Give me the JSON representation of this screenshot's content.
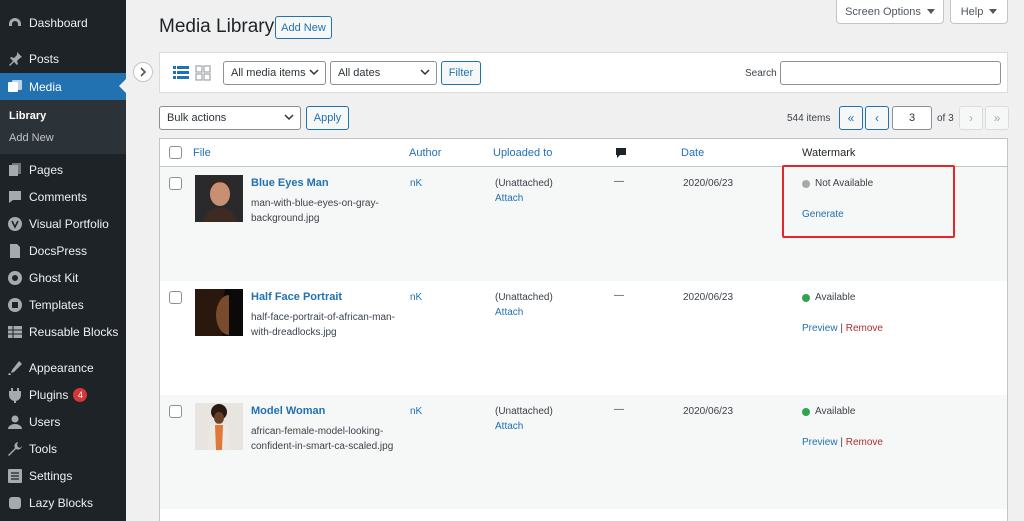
{
  "sidebar": {
    "items": [
      {
        "label": "Dashboard",
        "icon": "dashboard-icon"
      },
      {
        "label": "Posts",
        "icon": "pin-icon"
      },
      {
        "label": "Media",
        "icon": "media-icon"
      },
      {
        "label": "Pages",
        "icon": "pages-icon"
      },
      {
        "label": "Comments",
        "icon": "comments-icon"
      },
      {
        "label": "Visual Portfolio",
        "icon": "visual-portfolio-icon"
      },
      {
        "label": "DocsPress",
        "icon": "docs-icon"
      },
      {
        "label": "Ghost Kit",
        "icon": "ghost-kit-icon"
      },
      {
        "label": "Templates",
        "icon": "templates-icon"
      },
      {
        "label": "Reusable Blocks",
        "icon": "blocks-icon"
      },
      {
        "label": "Appearance",
        "icon": "appearance-icon"
      },
      {
        "label": "Plugins",
        "icon": "plugins-icon",
        "badge": "4"
      },
      {
        "label": "Users",
        "icon": "users-icon"
      },
      {
        "label": "Tools",
        "icon": "tools-icon"
      },
      {
        "label": "Settings",
        "icon": "settings-icon"
      },
      {
        "label": "Lazy Blocks",
        "icon": "lazy-blocks-icon"
      }
    ],
    "submenu": [
      {
        "label": "Library"
      },
      {
        "label": "Add New"
      }
    ]
  },
  "topbar": {
    "screen_options": "Screen Options",
    "help": "Help"
  },
  "header": {
    "title": "Media Library",
    "add_new": "Add New"
  },
  "filters": {
    "media_type": "All media items",
    "dates": "All dates",
    "filter_button": "Filter",
    "search_label": "Search"
  },
  "bulk": {
    "selected": "Bulk actions",
    "apply": "Apply"
  },
  "pagination": {
    "items": "544 items",
    "first": "«",
    "prev": "‹",
    "current": "3",
    "of": "of 3",
    "next": "›",
    "last": "»"
  },
  "table": {
    "columns": {
      "file": "File",
      "author": "Author",
      "uploaded_to": "Uploaded to",
      "date": "Date",
      "watermark": "Watermark"
    },
    "rows": [
      {
        "title": "Blue Eyes Man",
        "filename": "man-with-blue-eyes-on-gray-background.jpg",
        "author": "nK",
        "uploaded_to": "(Unattached)",
        "attach": "Attach",
        "comments": "—",
        "date": "2020/06/23",
        "wm_status": "Not Available",
        "wm_color": "#a7aaad",
        "wm_action": "Generate"
      },
      {
        "title": "Half Face Portrait",
        "filename": "half-face-portrait-of-african-man-with-dreadlocks.jpg",
        "author": "nK",
        "uploaded_to": "(Unattached)",
        "attach": "Attach",
        "comments": "—",
        "date": "2020/06/23",
        "wm_status": "Available",
        "wm_color": "#2ea44f",
        "wm_preview": "Preview",
        "wm_sep": "|",
        "wm_remove": "Remove"
      },
      {
        "title": "Model Woman",
        "filename": "african-female-model-looking-confident-in-smart-ca-scaled.jpg",
        "author": "nK",
        "uploaded_to": "(Unattached)",
        "attach": "Attach",
        "comments": "—",
        "date": "2020/06/23",
        "wm_status": "Available",
        "wm_color": "#2ea44f",
        "wm_preview": "Preview",
        "wm_sep": "|",
        "wm_remove": "Remove"
      }
    ]
  },
  "colors": {
    "accent": "#2271b1",
    "sidebar_bg": "#1d2327",
    "highlight": "#e5252a"
  }
}
